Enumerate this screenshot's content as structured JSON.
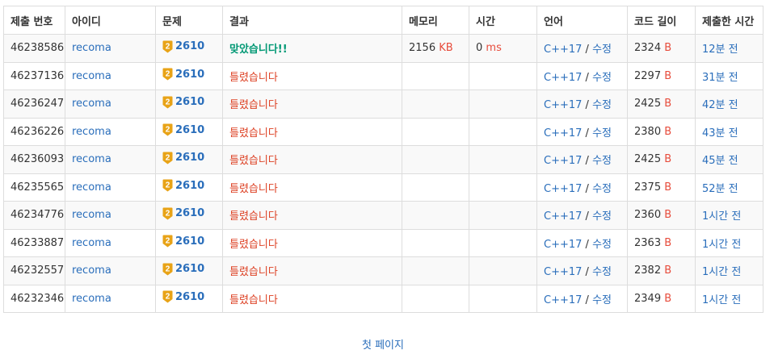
{
  "columns": [
    "제출 번호",
    "아이디",
    "문제",
    "결과",
    "메모리",
    "시간",
    "언어",
    "코드 길이",
    "제출한 시간"
  ],
  "tier_color": "#e8a317",
  "colors": {
    "link": "#2a6ebb",
    "accepted": "#009874",
    "wrong": "#dd4124",
    "unit": "#e74c3c"
  },
  "rows": [
    {
      "id": "46238586",
      "user": "recoma",
      "tier": "2",
      "problem": "2610",
      "result": "맞았습니다!!",
      "accepted": true,
      "memory": "2156",
      "memory_unit": "KB",
      "time": "0",
      "time_unit": "ms",
      "lang": "C++17",
      "edit": "수정",
      "length": "2324",
      "length_unit": "B",
      "submitted": "12분 전"
    },
    {
      "id": "46237136",
      "user": "recoma",
      "tier": "2",
      "problem": "2610",
      "result": "틀렸습니다",
      "accepted": false,
      "memory": "",
      "memory_unit": "",
      "time": "",
      "time_unit": "",
      "lang": "C++17",
      "edit": "수정",
      "length": "2297",
      "length_unit": "B",
      "submitted": "31분 전"
    },
    {
      "id": "46236247",
      "user": "recoma",
      "tier": "2",
      "problem": "2610",
      "result": "틀렸습니다",
      "accepted": false,
      "memory": "",
      "memory_unit": "",
      "time": "",
      "time_unit": "",
      "lang": "C++17",
      "edit": "수정",
      "length": "2425",
      "length_unit": "B",
      "submitted": "42분 전"
    },
    {
      "id": "46236226",
      "user": "recoma",
      "tier": "2",
      "problem": "2610",
      "result": "틀렸습니다",
      "accepted": false,
      "memory": "",
      "memory_unit": "",
      "time": "",
      "time_unit": "",
      "lang": "C++17",
      "edit": "수정",
      "length": "2380",
      "length_unit": "B",
      "submitted": "43분 전"
    },
    {
      "id": "46236093",
      "user": "recoma",
      "tier": "2",
      "problem": "2610",
      "result": "틀렸습니다",
      "accepted": false,
      "memory": "",
      "memory_unit": "",
      "time": "",
      "time_unit": "",
      "lang": "C++17",
      "edit": "수정",
      "length": "2425",
      "length_unit": "B",
      "submitted": "45분 전"
    },
    {
      "id": "46235565",
      "user": "recoma",
      "tier": "2",
      "problem": "2610",
      "result": "틀렸습니다",
      "accepted": false,
      "memory": "",
      "memory_unit": "",
      "time": "",
      "time_unit": "",
      "lang": "C++17",
      "edit": "수정",
      "length": "2375",
      "length_unit": "B",
      "submitted": "52분 전"
    },
    {
      "id": "46234776",
      "user": "recoma",
      "tier": "2",
      "problem": "2610",
      "result": "틀렸습니다",
      "accepted": false,
      "memory": "",
      "memory_unit": "",
      "time": "",
      "time_unit": "",
      "lang": "C++17",
      "edit": "수정",
      "length": "2360",
      "length_unit": "B",
      "submitted": "1시간 전"
    },
    {
      "id": "46233887",
      "user": "recoma",
      "tier": "2",
      "problem": "2610",
      "result": "틀렸습니다",
      "accepted": false,
      "memory": "",
      "memory_unit": "",
      "time": "",
      "time_unit": "",
      "lang": "C++17",
      "edit": "수정",
      "length": "2363",
      "length_unit": "B",
      "submitted": "1시간 전"
    },
    {
      "id": "46232557",
      "user": "recoma",
      "tier": "2",
      "problem": "2610",
      "result": "틀렸습니다",
      "accepted": false,
      "memory": "",
      "memory_unit": "",
      "time": "",
      "time_unit": "",
      "lang": "C++17",
      "edit": "수정",
      "length": "2382",
      "length_unit": "B",
      "submitted": "1시간 전"
    },
    {
      "id": "46232346",
      "user": "recoma",
      "tier": "2",
      "problem": "2610",
      "result": "틀렸습니다",
      "accepted": false,
      "memory": "",
      "memory_unit": "",
      "time": "",
      "time_unit": "",
      "lang": "C++17",
      "edit": "수정",
      "length": "2349",
      "length_unit": "B",
      "submitted": "1시간 전"
    }
  ],
  "pager": {
    "first_page": "첫 페이지"
  }
}
